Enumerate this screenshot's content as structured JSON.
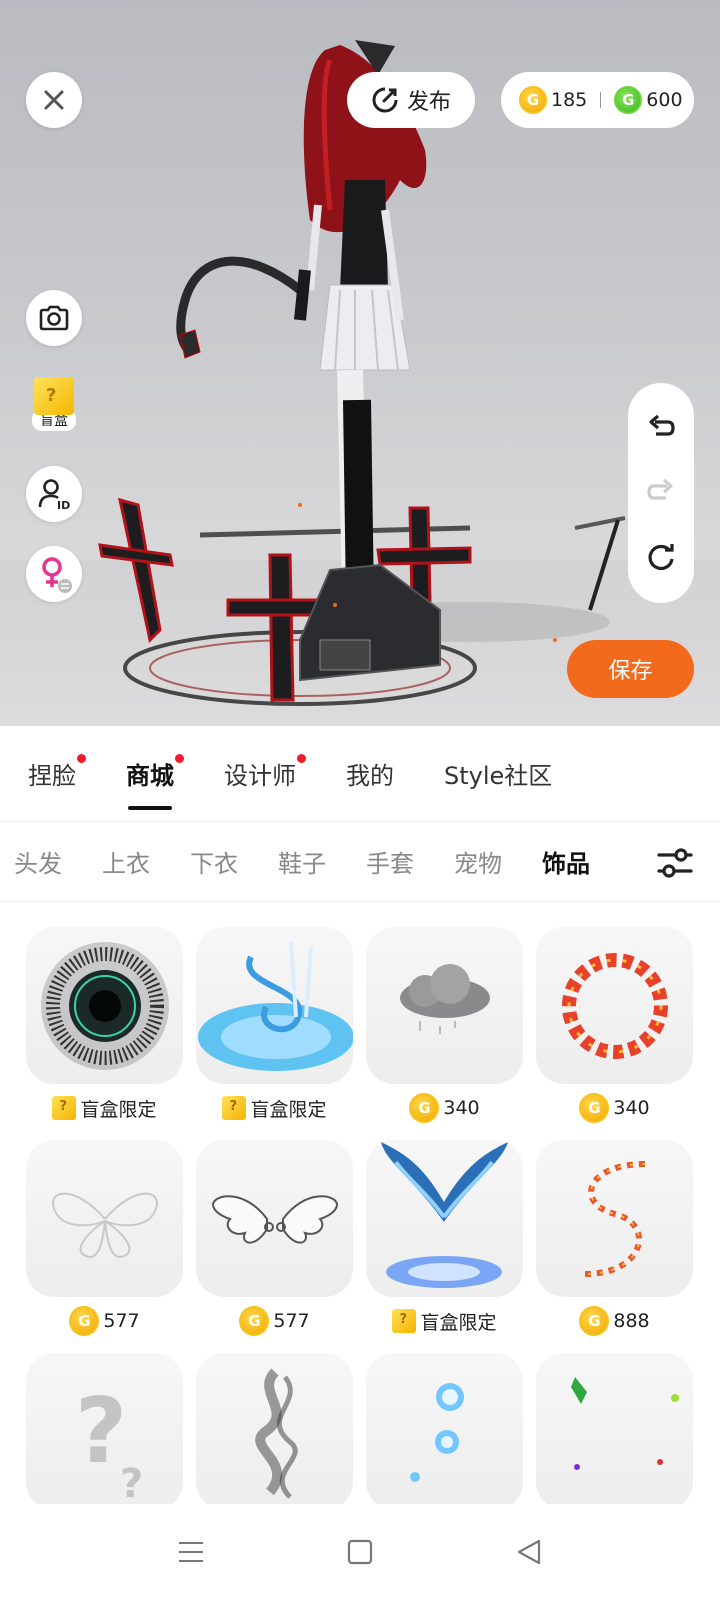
{
  "viewport": {
    "publish_label": "发布",
    "gold_coins": "185",
    "green_coins": "600",
    "blindbox_label": "盲盒",
    "save_label": "保存"
  },
  "main_tabs": [
    {
      "label": "捏脸",
      "dot": true
    },
    {
      "label": "商城",
      "dot": true,
      "active": true
    },
    {
      "label": "设计师",
      "dot": true
    },
    {
      "label": "我的",
      "dot": false
    },
    {
      "label": "Style社区",
      "dot": false
    }
  ],
  "categories": [
    {
      "label": "头发"
    },
    {
      "label": "上衣"
    },
    {
      "label": "下衣"
    },
    {
      "label": "鞋子"
    },
    {
      "label": "手套"
    },
    {
      "label": "宠物"
    },
    {
      "label": "饰品",
      "active": true
    }
  ],
  "items": [
    {
      "name": "dark-portal",
      "price": "盲盒限定",
      "type": "blindbox"
    },
    {
      "name": "water-vortex",
      "price": "盲盒限定",
      "type": "blindbox"
    },
    {
      "name": "rain-cloud",
      "price": "340",
      "type": "coin"
    },
    {
      "name": "rune-circle",
      "price": "340",
      "type": "coin"
    },
    {
      "name": "butterfly-wings",
      "price": "577",
      "type": "coin"
    },
    {
      "name": "angel-wings",
      "price": "577",
      "type": "coin"
    },
    {
      "name": "blue-wings-portal",
      "price": "盲盒限定",
      "type": "blindbox"
    },
    {
      "name": "leaf-swirl",
      "price": "888",
      "type": "coin"
    },
    {
      "name": "question-mark",
      "price": "",
      "type": "none"
    },
    {
      "name": "smoke",
      "price": "",
      "type": "none"
    },
    {
      "name": "blue-orbs",
      "price": "",
      "type": "none"
    },
    {
      "name": "butterflies",
      "price": "",
      "type": "none"
    }
  ],
  "colors": {
    "accent": "#f26a1b",
    "dot": "#f21b2c",
    "gold": "#f7c21d",
    "green": "#39b51b"
  }
}
